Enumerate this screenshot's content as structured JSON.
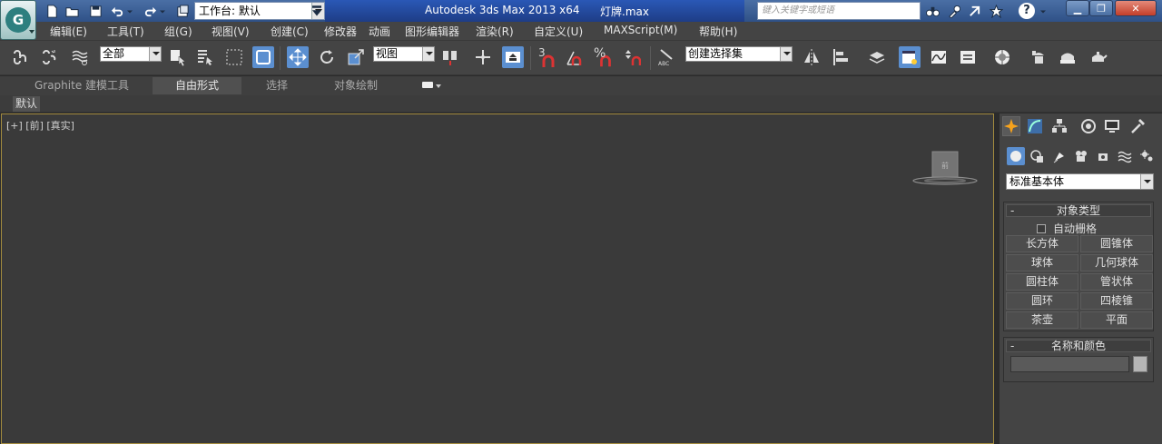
{
  "titlebar": {
    "app_title": "Autodesk 3ds Max  2013 x64",
    "file_title": "灯牌.max",
    "workspace": "工作台: 默认",
    "search_placeholder": "键入关键字或短语",
    "help_label": "?",
    "colors": {
      "bar": "#2f5187",
      "title_bg": "#1e3d86"
    }
  },
  "menubar": {
    "items": [
      "编辑(E)",
      "工具(T)",
      "组(G)",
      "视图(V)",
      "创建(C)",
      "修改器",
      "动画",
      "图形编辑器",
      "渲染(R)",
      "自定义(U)",
      "MAXScript(M)",
      "帮助(H)"
    ]
  },
  "toolbar": {
    "selection_filter": "全部",
    "ref_coord": "视图",
    "named_selection": "创建选择集",
    "snap_label": "3",
    "angle_label": "%",
    "active_color": "#5b8fd0"
  },
  "ribbon": {
    "tabs": [
      "Graphite 建模工具",
      "自由形式",
      "选择",
      "对象绘制"
    ],
    "active_tab": "自由形式",
    "sub_label": "默认"
  },
  "viewport": {
    "label": "[+] [前] [真实]",
    "viewcube_face": "前",
    "border_color": "#a38b3f"
  },
  "command_panel": {
    "category": "标准基本体",
    "object_type_title": "对象类型",
    "autogrid_label": "自动栅格",
    "object_buttons": [
      "长方体",
      "圆锥体",
      "球体",
      "几何球体",
      "圆柱体",
      "管状体",
      "圆环",
      "四棱锥",
      "茶壶",
      "平面"
    ],
    "name_color_title": "名称和颜色",
    "swatch_color": "#b5b5b5"
  }
}
